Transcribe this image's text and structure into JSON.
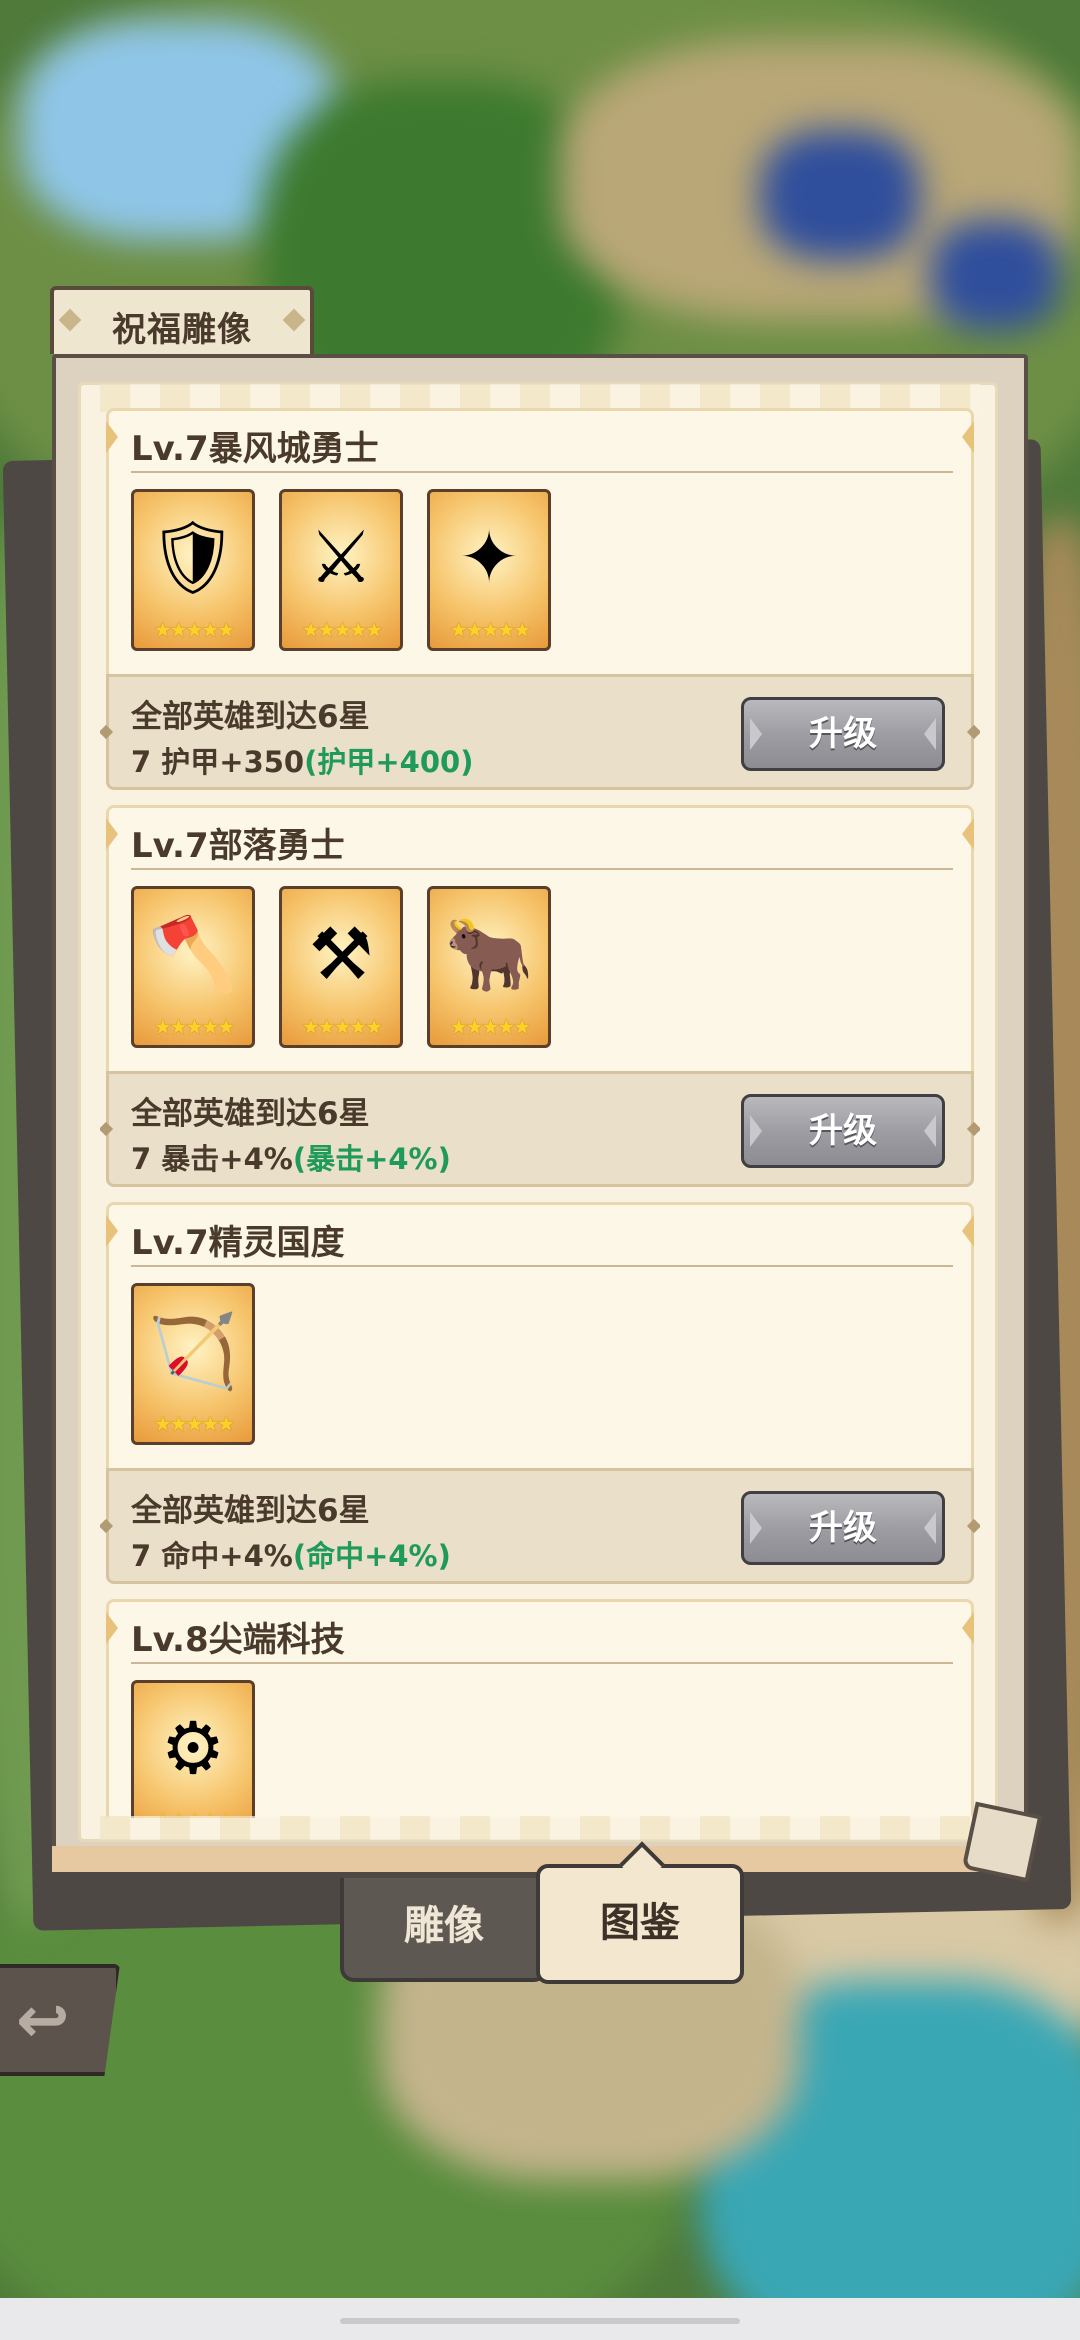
{
  "header": {
    "title": "祝福雕像"
  },
  "sets": [
    {
      "title": "Lv.7暴风城勇士",
      "condition": "全部英雄到达6星",
      "bonus_prefix": "7 护甲+350",
      "bonus_next": "(护甲+400)",
      "button": "升级",
      "heroes": [
        {
          "icon": "knight-hero-icon",
          "glyph": "🛡",
          "stars": "★★★★★"
        },
        {
          "icon": "swordsman-hero-icon",
          "glyph": "⚔",
          "stars": "★★★★★"
        },
        {
          "icon": "priest-hero-icon",
          "glyph": "✦",
          "stars": "★★★★★"
        }
      ]
    },
    {
      "title": "Lv.7部落勇士",
      "condition": "全部英雄到达6星",
      "bonus_prefix": "7 暴击+4%",
      "bonus_next": "(暴击+4%)",
      "button": "升级",
      "heroes": [
        {
          "icon": "orc-warrior-hero-icon",
          "glyph": "🪓",
          "stars": "★★★★★"
        },
        {
          "icon": "beast-warrior-hero-icon",
          "glyph": "⚒",
          "stars": "★★★★★"
        },
        {
          "icon": "tauren-hero-icon",
          "glyph": "🐂",
          "stars": "★★★★★"
        }
      ]
    },
    {
      "title": "Lv.7精灵国度",
      "condition": "全部英雄到达6星",
      "bonus_prefix": "7 命中+4%",
      "bonus_next": "(命中+4%)",
      "button": "升级",
      "heroes": [
        {
          "icon": "elf-archer-hero-icon",
          "glyph": "🏹",
          "stars": "★★★★★"
        }
      ]
    },
    {
      "title": "Lv.8尖端科技",
      "condition": "",
      "bonus_prefix": "",
      "bonus_next": "",
      "button": "",
      "heroes": [
        {
          "icon": "gnome-engineer-hero-icon",
          "glyph": "⚙",
          "stars": "★★★★★"
        }
      ]
    }
  ],
  "tabs": {
    "statue": "雕像",
    "codex": "图鉴",
    "selected": "codex"
  },
  "back": {
    "glyph": "↩",
    "icon": "back-arrow-icon"
  },
  "colors": {
    "bonus_next": "#1f9a5a",
    "button_gray": "#9d9da3",
    "page": "#f9f2e1"
  }
}
